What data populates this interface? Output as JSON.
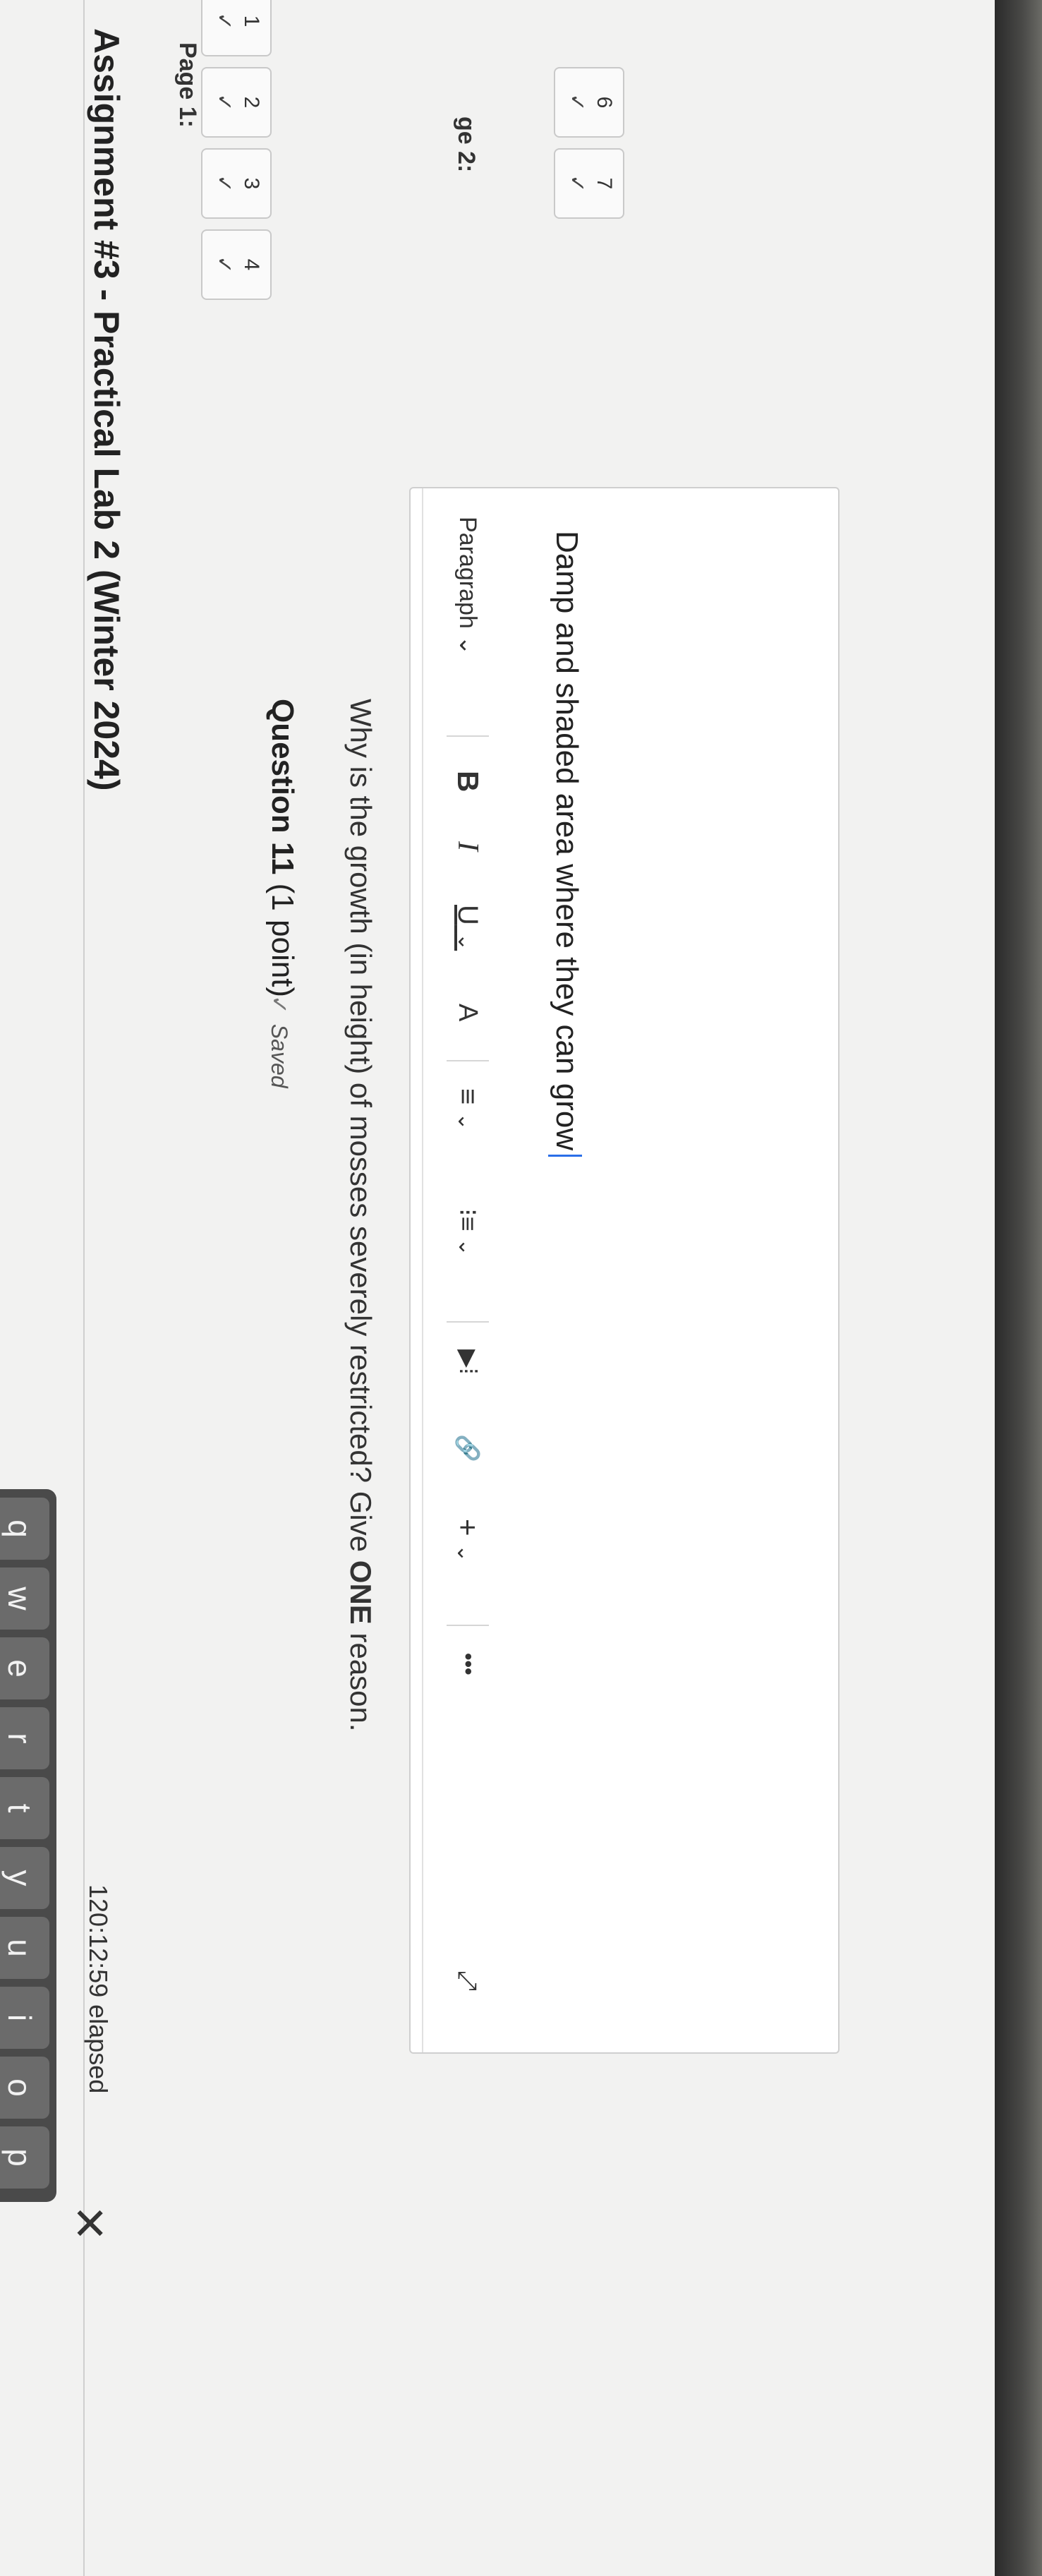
{
  "header": {
    "title": "Assignment #3 - Practical Lab 2 (Winter 2024)",
    "timer": "120:12:59 elapsed",
    "close_icon": "close-icon",
    "close_glyph": "✕"
  },
  "navigation": {
    "page1_label": "Page 1:",
    "page2_label": "ge 2:",
    "page1_questions": [
      {
        "number": "1",
        "check": "✓"
      },
      {
        "number": "2",
        "check": "✓"
      },
      {
        "number": "3",
        "check": "✓"
      },
      {
        "number": "4",
        "check": "✓"
      }
    ],
    "page2_questions": [
      {
        "number": "6",
        "check": "✓"
      },
      {
        "number": "7",
        "check": "✓"
      }
    ]
  },
  "question": {
    "number_label": "Question 11",
    "points": "(1 point)",
    "saved": "Saved",
    "text_before": "Why is the growth (in height) of mosses severely restricted? Give ",
    "text_emphasis": "ONE",
    "text_after": " reason."
  },
  "editor": {
    "paragraph_label": "Paragraph",
    "answer": "Damp and shaded area where they can grow",
    "tools": {
      "bold": "B",
      "italic": "I",
      "underline": "U",
      "text_color": "A",
      "align": "≡",
      "list": "⁝≡",
      "media": "▶⁞",
      "link": "🔗",
      "insert": "+",
      "more": "•••",
      "fullscreen": "⤢",
      "dropdown": "⌄"
    }
  },
  "keyboard": {
    "keys": [
      "q",
      "w",
      "e",
      "r",
      "t",
      "y",
      "u",
      "i",
      "o",
      "p"
    ]
  }
}
